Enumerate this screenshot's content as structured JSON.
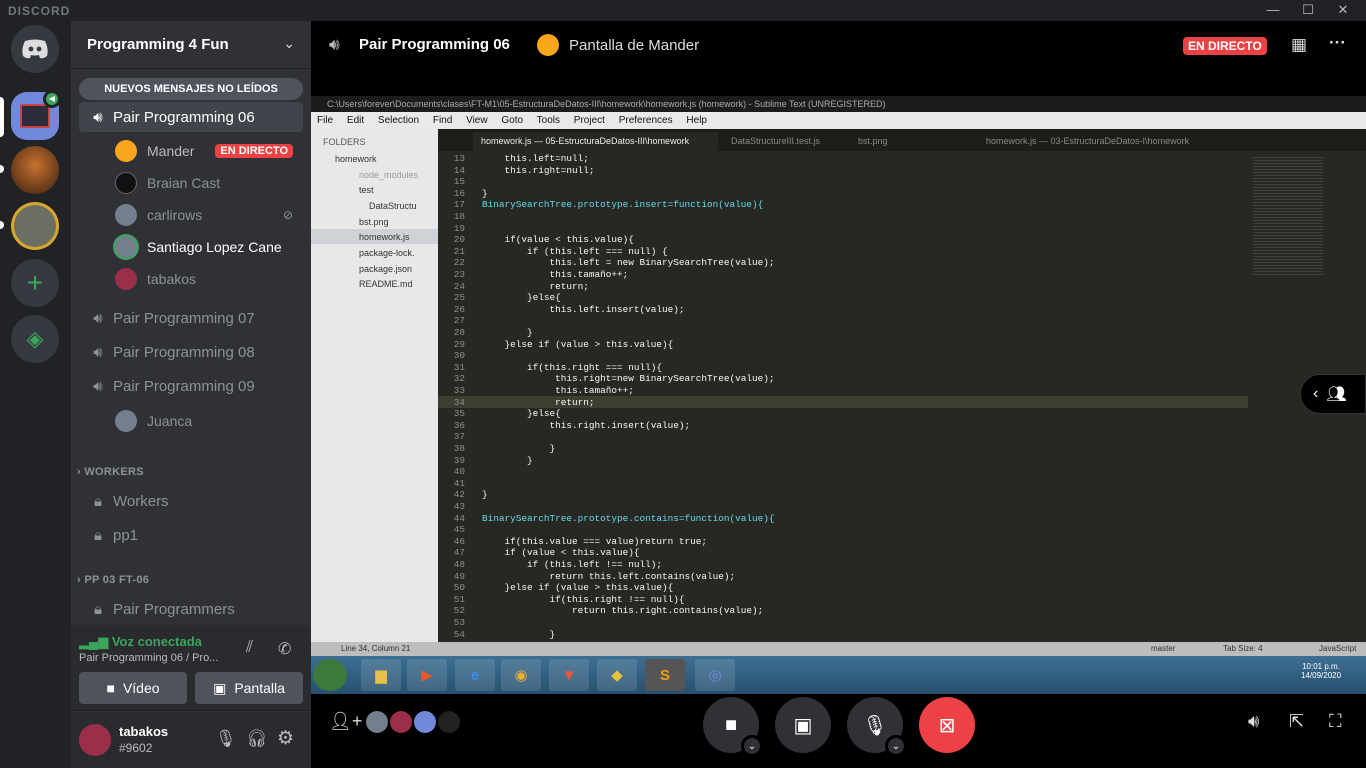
{
  "app": {
    "brand": "DISCORD"
  },
  "server": {
    "name": "Programming 4 Fun"
  },
  "sidebar": {
    "unread_banner": "NUEVOS MENSAJES NO LEÍDOS",
    "channels": [
      {
        "label": "Pair Programming 06"
      },
      {
        "label": "Pair Programming 07"
      },
      {
        "label": "Pair Programming 08"
      },
      {
        "label": "Pair Programming 09"
      }
    ],
    "voice_users_06": [
      {
        "name": "Mander",
        "badge": "EN DIRECTO"
      },
      {
        "name": "Braian Cast"
      },
      {
        "name": "carlirows"
      },
      {
        "name": "Santiago Lopez Cane"
      },
      {
        "name": "tabakos"
      }
    ],
    "voice_users_09": [
      {
        "name": "Juanca"
      }
    ],
    "categories": [
      {
        "label": "WORKERS",
        "channels": [
          "Workers",
          "pp1"
        ]
      },
      {
        "label": "PP 03 FT-06",
        "channels": [
          "Pair Programmers"
        ]
      }
    ]
  },
  "voice": {
    "status": "Voz conectada",
    "channel": "Pair Programming 06 / Pro...",
    "video_label": "Vídeo",
    "screen_label": "Pantalla"
  },
  "user": {
    "name": "tabakos",
    "tag": "#9602"
  },
  "header": {
    "channel": "Pair Programming 06",
    "stream": "Pantalla de Mander",
    "live": "EN DIRECTO"
  },
  "sublime": {
    "title": "C:\\Users\\forever\\Documents\\clases\\FT-M1\\05-EstructuraDeDatos-III\\homework\\homework.js (homework) - Sublime Text (UNREGISTERED)",
    "menu": [
      "File",
      "Edit",
      "Selection",
      "Find",
      "View",
      "Goto",
      "Tools",
      "Project",
      "Preferences",
      "Help"
    ],
    "folders_label": "FOLDERS",
    "files": [
      "homework",
      "node_modules",
      "test",
      "DataStructu",
      "bst.png",
      "homework.js",
      "package-lock.",
      "package.json",
      "README.md"
    ],
    "tabs": [
      "homework.js — 05-EstructuraDeDatos-III\\homework",
      "DataStructureIII.test.js",
      "bst.png",
      "homework.js — 03-EstructuraDeDatos-I\\homework"
    ],
    "status_left": "Line 34, Column 21",
    "status_branch": "master",
    "status_tab": "Tab Size: 4",
    "status_lang": "JavaScript",
    "clock_time": "10:01 p.m.",
    "clock_date": "14/09/2020",
    "code": [
      {
        "n": "13",
        "t": "    this.left=null;"
      },
      {
        "n": "14",
        "t": "    this.right=null;"
      },
      {
        "n": "15",
        "t": ""
      },
      {
        "n": "16",
        "t": "}"
      },
      {
        "n": "17",
        "t": "BinarySearchTree.prototype.insert=function(value){"
      },
      {
        "n": "18",
        "t": ""
      },
      {
        "n": "19",
        "t": ""
      },
      {
        "n": "20",
        "t": "    if(value < this.value){"
      },
      {
        "n": "21",
        "t": "        if (this.left === null) {"
      },
      {
        "n": "22",
        "t": "            this.left = new BinarySearchTree(value);"
      },
      {
        "n": "23",
        "t": "            this.tamaño++;"
      },
      {
        "n": "24",
        "t": "            return;"
      },
      {
        "n": "25",
        "t": "        }else{"
      },
      {
        "n": "26",
        "t": "            this.left.insert(value);"
      },
      {
        "n": "27",
        "t": ""
      },
      {
        "n": "28",
        "t": "        }"
      },
      {
        "n": "29",
        "t": "    }else if (value > this.value){"
      },
      {
        "n": "30",
        "t": ""
      },
      {
        "n": "31",
        "t": "        if(this.right === null){"
      },
      {
        "n": "32",
        "t": "             this.right=new BinarySearchTree(value);"
      },
      {
        "n": "33",
        "t": "             this.tamaño++;"
      },
      {
        "n": "34",
        "t": "             return;"
      },
      {
        "n": "35",
        "t": "        }else{"
      },
      {
        "n": "36",
        "t": "            this.right.insert(value);"
      },
      {
        "n": "37",
        "t": ""
      },
      {
        "n": "38",
        "t": "            }"
      },
      {
        "n": "39",
        "t": "        }"
      },
      {
        "n": "40",
        "t": ""
      },
      {
        "n": "41",
        "t": ""
      },
      {
        "n": "42",
        "t": "}"
      },
      {
        "n": "43",
        "t": ""
      },
      {
        "n": "44",
        "t": "BinarySearchTree.prototype.contains=function(value){"
      },
      {
        "n": "45",
        "t": ""
      },
      {
        "n": "46",
        "t": "    if(this.value === value)return true;"
      },
      {
        "n": "47",
        "t": "    if (value < this.value){"
      },
      {
        "n": "48",
        "t": "        if (this.left !== null);"
      },
      {
        "n": "49",
        "t": "            return this.left.contains(value);"
      },
      {
        "n": "50",
        "t": "    }else if (value > this.value){"
      },
      {
        "n": "51",
        "t": "            if(this.right !== null){"
      },
      {
        "n": "52",
        "t": "                return this.right.contains(value);"
      },
      {
        "n": "53",
        "t": ""
      },
      {
        "n": "54",
        "t": "            }"
      }
    ]
  },
  "colors": {
    "blurple": "#5865f2",
    "green": "#3ba55c",
    "red": "#ed4245",
    "bg_dark": "#202225",
    "bg_side": "#2f3136"
  }
}
